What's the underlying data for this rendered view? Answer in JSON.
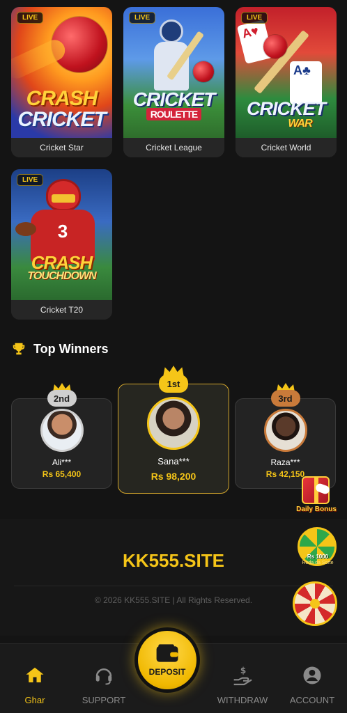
{
  "games": [
    {
      "name": "Cricket Star",
      "badge": "LIVE",
      "logo_line1": "CRASH",
      "logo_line2": "CRICKET"
    },
    {
      "name": "Cricket League",
      "badge": "LIVE",
      "logo_line1": "CRICKET",
      "logo_line2": "ROULETTE"
    },
    {
      "name": "Cricket World",
      "badge": "LIVE",
      "logo_line1": "CRICKET",
      "logo_line2": "WAR"
    },
    {
      "name": "Cricket T20",
      "badge": "LIVE",
      "logo_line1": "CRASH",
      "logo_line2": "TOUCHDOWN"
    }
  ],
  "top_winners": {
    "title": "Top Winners",
    "icon": "trophy-icon",
    "list": [
      {
        "rank": "2nd",
        "name": "Ali***",
        "amount": "Rs 65,400"
      },
      {
        "rank": "1st",
        "name": "Sana***",
        "amount": "Rs 98,200"
      },
      {
        "rank": "3rd",
        "name": "Raza***",
        "amount": "Rs 42,150"
      }
    ]
  },
  "promos": {
    "daily_bonus": "Daily Bonus",
    "wheel_amount": "Rs 1000",
    "wheel_label": "Roda da Sorte"
  },
  "footer": {
    "site": "KK555.SITE",
    "copyright": "© 2026 KK555.SITE | All Rights Reserved."
  },
  "nav": {
    "home": "Ghar",
    "support": "SUPPORT",
    "deposit": "DEPOSIT",
    "withdraw": "WITHDRAW",
    "account": "ACCOUNT"
  },
  "colors": {
    "accent": "#f5c518",
    "background": "#141414",
    "card": "#2a2a2a"
  }
}
